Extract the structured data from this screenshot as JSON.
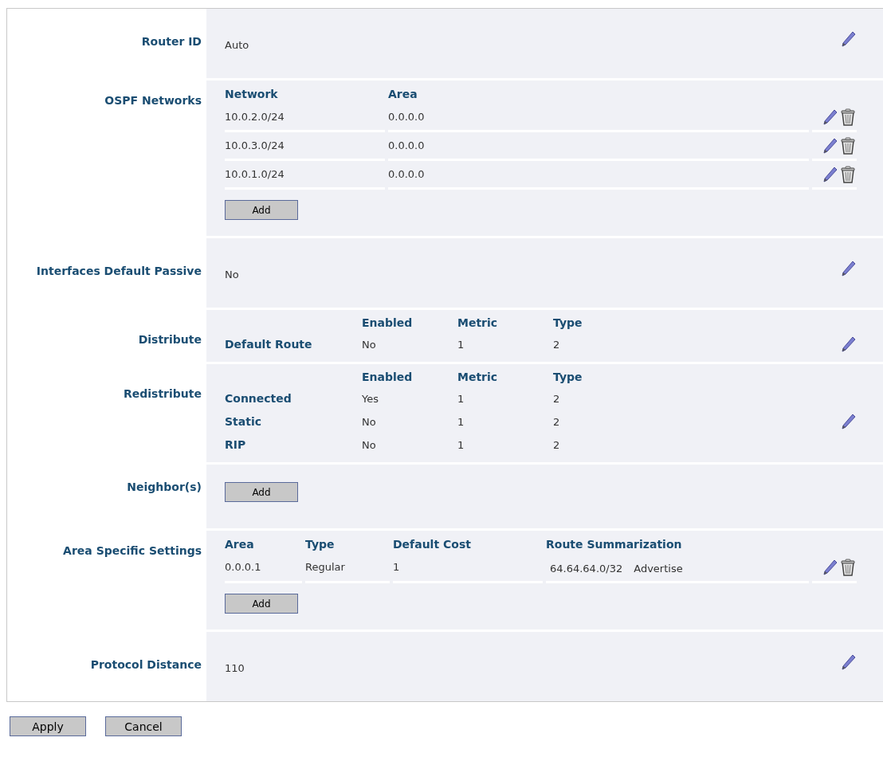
{
  "sections": [
    {
      "label": "Router ID",
      "kind": "value",
      "value": "Auto",
      "edit": true
    },
    {
      "label": "OSPF Networks",
      "kind": "table",
      "columns": [
        "Network",
        "Area"
      ],
      "rows": [
        {
          "cells": [
            "10.0.2.0/24",
            "0.0.0.0"
          ],
          "edit": true,
          "delete": true
        },
        {
          "cells": [
            "10.0.3.0/24",
            "0.0.0.0"
          ],
          "edit": true,
          "delete": true
        },
        {
          "cells": [
            "10.0.1.0/24",
            "0.0.0.0"
          ],
          "edit": true,
          "delete": true
        }
      ],
      "add_button": "Add"
    },
    {
      "label": "Interfaces Default Passive",
      "kind": "value",
      "value": "No",
      "edit": true
    },
    {
      "label": "Distribute",
      "kind": "matrix",
      "columns": [
        "Enabled",
        "Metric",
        "Type"
      ],
      "rows": [
        {
          "label": "Default Route",
          "cells": [
            "No",
            "1",
            "2"
          ]
        }
      ],
      "edit": true
    },
    {
      "label": "Redistribute",
      "kind": "matrix",
      "columns": [
        "Enabled",
        "Metric",
        "Type"
      ],
      "rows": [
        {
          "label": "Connected",
          "cells": [
            "Yes",
            "1",
            "2"
          ]
        },
        {
          "label": "Static",
          "cells": [
            "No",
            "1",
            "2"
          ]
        },
        {
          "label": "RIP",
          "cells": [
            "No",
            "1",
            "2"
          ]
        }
      ],
      "edit": true
    },
    {
      "label": "Neighbor(s)",
      "kind": "add",
      "add_button": "Add"
    },
    {
      "label": "Area Specific Settings",
      "kind": "table",
      "columns": [
        "Area",
        "Type",
        "Default Cost",
        "Route Summarization"
      ],
      "rows": [
        {
          "cells": [
            "0.0.0.1",
            "Regular",
            "1"
          ],
          "summary": [
            "64.64.64.0/32",
            "Advertise"
          ],
          "edit": true,
          "delete": true
        }
      ],
      "add_button": "Add"
    },
    {
      "label": "Protocol Distance",
      "kind": "value",
      "value": "110",
      "edit": true
    }
  ],
  "buttons": [
    "Apply",
    "Cancel"
  ]
}
